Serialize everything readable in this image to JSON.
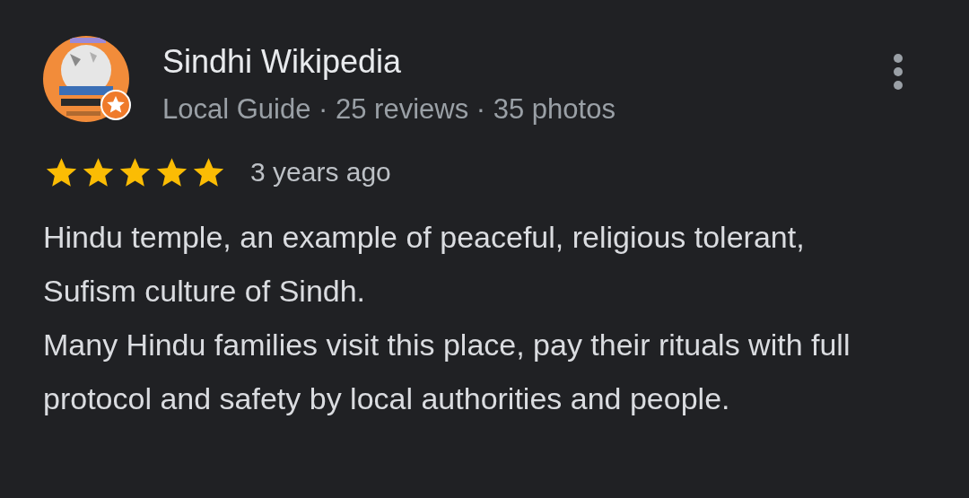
{
  "review": {
    "author": "Sindhi Wikipedia",
    "meta": "Local Guide · 25 reviews · 35 photos",
    "local_guide": true,
    "stars": 5,
    "time": "3 years ago",
    "paragraphs": [
      "Hindu temple, an example of peaceful, religious tolerant, Sufism culture of Sindh.",
      "Many Hindu families visit this place, pay their rituals with full protocol and safety by local authorities and people."
    ]
  }
}
